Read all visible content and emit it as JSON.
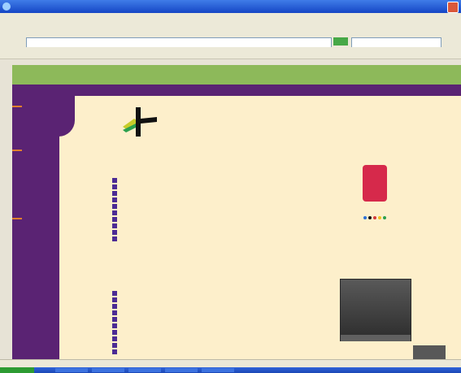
{
  "browser": {
    "title": "",
    "address": "",
    "search_placeholder": ""
  },
  "site": {
    "banner_title": "",
    "header_words": [
      "",
      "",
      ""
    ],
    "section1_title": "",
    "section2_title": "",
    "right_red_text": "",
    "right_link_text": "",
    "right_caption_text": "",
    "status_text": "",
    "status_right": ""
  },
  "colors": {
    "sidebar": "#5a2373",
    "banner": "#8db95a",
    "content": "#fdefcb",
    "link": "#2b31d6",
    "title": "#3d1f6e",
    "accent": "#e07f2d",
    "red": "#d42020"
  },
  "icons": {
    "window": "ie-icon",
    "close": "close-icon",
    "logo": "olympic-logo-icon",
    "emblem": "beijing-emblem-icon",
    "photo": "photo-icon"
  }
}
